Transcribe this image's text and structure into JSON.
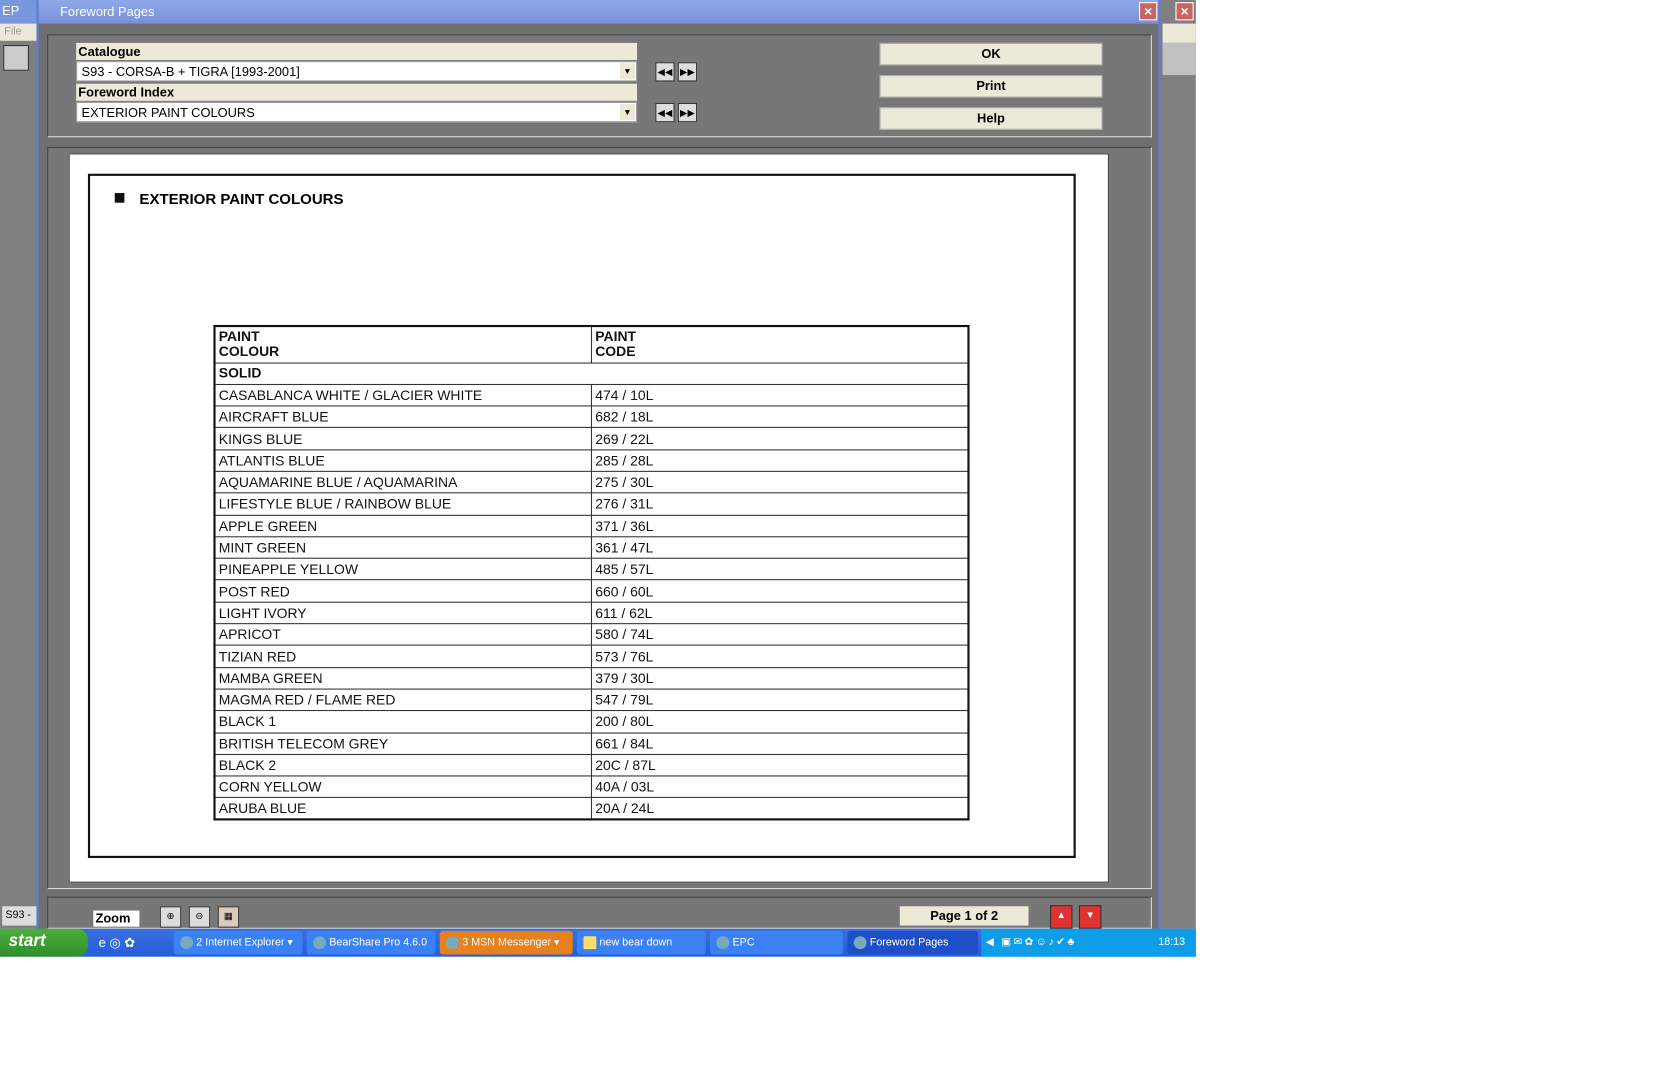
{
  "back_window": {
    "title": "EP",
    "menu": "File",
    "status": "S93 -"
  },
  "dialog": {
    "title": "Foreword Pages",
    "catalogue": {
      "label": "Catalogue",
      "value": "S93 - CORSA-B + TIGRA    [1993-2001]"
    },
    "foreword_index": {
      "label": "Foreword Index",
      "value": "EXTERIOR PAINT COLOURS"
    },
    "buttons": {
      "ok": "OK",
      "print": "Print",
      "help": "Help"
    },
    "page_heading": "EXTERIOR PAINT COLOURS",
    "table": {
      "headers": [
        "PAINT\nCOLOUR",
        "PAINT\nCODE"
      ],
      "section": "SOLID",
      "rows": [
        [
          "CASABLANCA WHITE / GLACIER WHITE",
          "474 / 10L"
        ],
        [
          "AIRCRAFT BLUE",
          "682 / 18L"
        ],
        [
          "KINGS BLUE",
          "269 / 22L"
        ],
        [
          "ATLANTIS BLUE",
          "285 / 28L"
        ],
        [
          "AQUAMARINE BLUE / AQUAMARINA",
          "275 / 30L"
        ],
        [
          "LIFESTYLE BLUE / RAINBOW BLUE",
          "276 / 31L"
        ],
        [
          "APPLE GREEN",
          "371 / 36L"
        ],
        [
          "MINT GREEN",
          "361 / 47L"
        ],
        [
          "PINEAPPLE YELLOW",
          "485 / 57L"
        ],
        [
          "POST RED",
          "660 / 60L"
        ],
        [
          "LIGHT IVORY",
          "611 / 62L"
        ],
        [
          "APRICOT",
          "580 / 74L"
        ],
        [
          "TIZIAN RED",
          "573 / 76L"
        ],
        [
          "MAMBA GREEN",
          "379 / 30L"
        ],
        [
          "MAGMA RED / FLAME RED",
          "547 / 79L"
        ],
        [
          "BLACK 1",
          "200 / 80L"
        ],
        [
          "BRITISH TELECOM GREY",
          "661 / 84L"
        ],
        [
          "BLACK 2",
          "20C / 87L"
        ],
        [
          "CORN YELLOW",
          "40A / 03L"
        ],
        [
          "ARUBA BLUE",
          "20A / 24L"
        ]
      ]
    },
    "zoom_label": "Zoom",
    "page_indicator": "Page 1 of 2"
  },
  "taskbar": {
    "start": "start",
    "tasks": [
      "2 Internet Explorer",
      "BearShare Pro 4.6.0",
      "3 MSN Messenger",
      "new bear down",
      "EPC",
      "Foreword Pages"
    ],
    "clock": "18:13"
  }
}
